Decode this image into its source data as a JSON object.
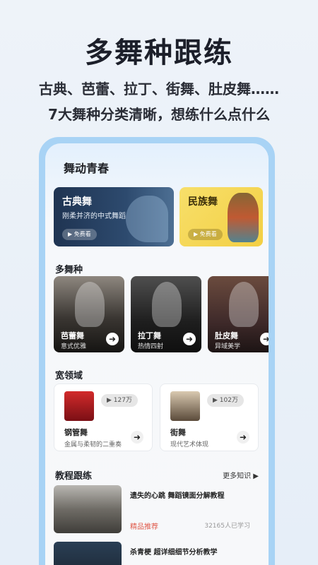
{
  "promo": {
    "headline": "多舞种跟练",
    "sub1": "古典、芭蕾、拉丁、街舞、肚皮舞……",
    "sub2": "7大舞种分类清晰，想练什么点什么"
  },
  "app": {
    "title": "舞动青春",
    "banners": [
      {
        "title": "古典舞",
        "desc": "刚柔并济的中式舞蹈",
        "pill": "▶ 免费看"
      },
      {
        "title": "民族舞",
        "desc": "",
        "pill": "▶ 免费看"
      }
    ],
    "sections": {
      "dance": "多舞种",
      "field": "宽领域",
      "course": "教程跟练",
      "more": "更多知识 ▶"
    },
    "dance_cards": [
      {
        "title": "芭蕾舞",
        "sub": "意式优雅",
        "arrow": "➜"
      },
      {
        "title": "拉丁舞",
        "sub": "热情四射",
        "arrow": "➜"
      },
      {
        "title": "肚皮舞",
        "sub": "异域美学",
        "arrow": "➜"
      }
    ],
    "field_cards": [
      {
        "title": "钢管舞",
        "sub": "金属与柔韧的二重奏",
        "count": "▶ 127万",
        "arrow": "➜"
      },
      {
        "title": "街舞",
        "sub": "现代艺术体现",
        "count": "▶ 102万",
        "arrow": "➜"
      }
    ],
    "courses": [
      {
        "title": "遗失的心跳 舞蹈镜面分解教程",
        "tag": "精品推荐",
        "count": "32165人已学习"
      },
      {
        "title": "杀青梗 超详细细节分析教学",
        "tag": "",
        "count": ""
      }
    ]
  }
}
